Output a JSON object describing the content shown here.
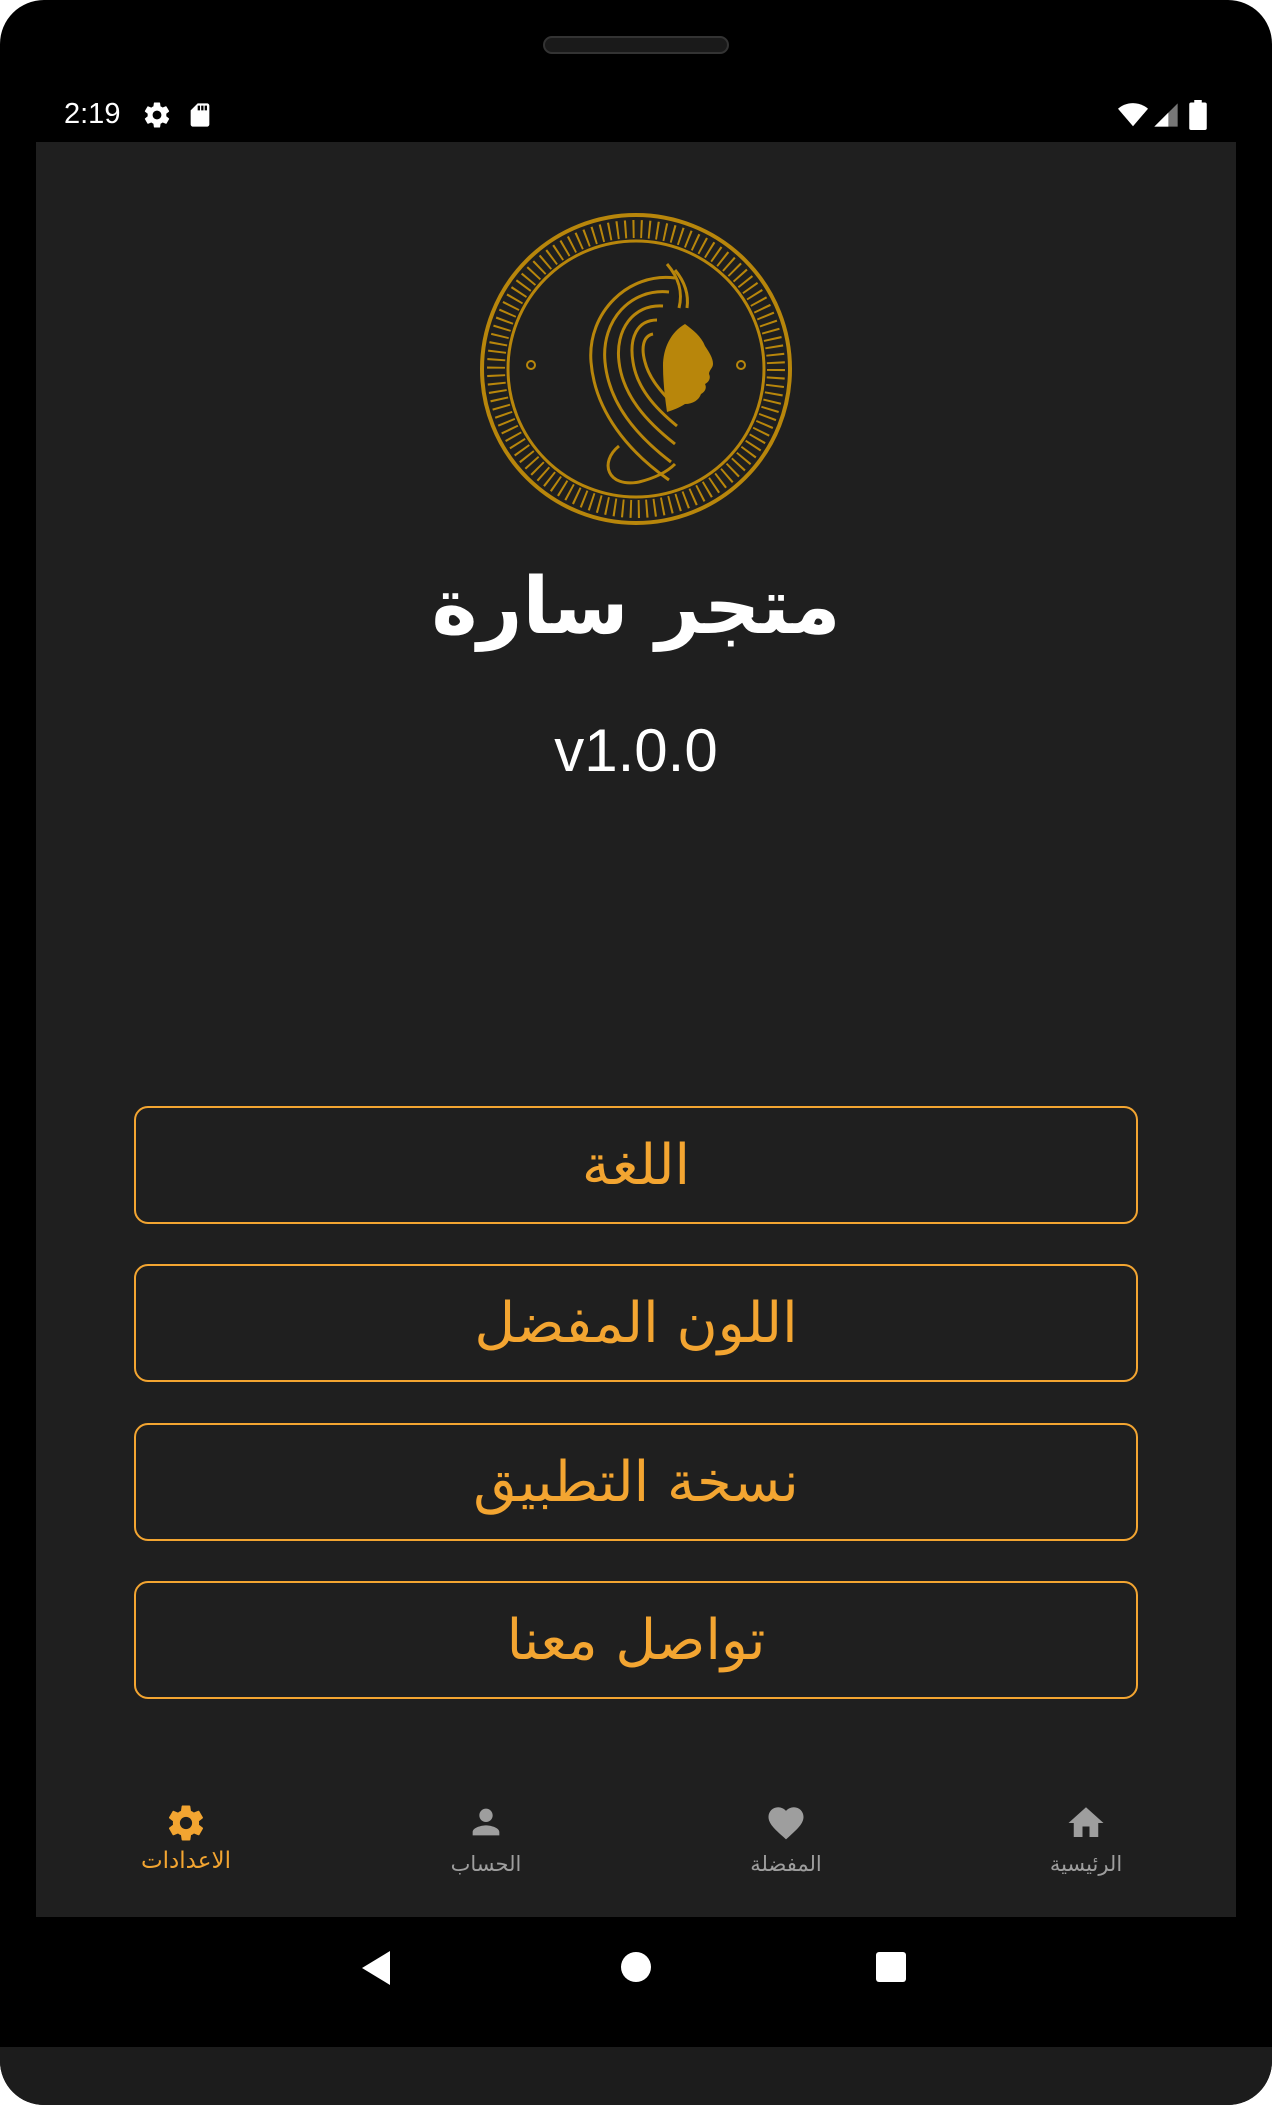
{
  "status_bar": {
    "time": "2:19",
    "left_icons": [
      "gear-icon",
      "sd-card-icon"
    ],
    "right_icons": [
      "wifi-icon",
      "signal-icon",
      "battery-icon"
    ]
  },
  "app": {
    "title": "متجر سارة",
    "version": "v1.0.0",
    "logo": "woman-profile-coin-logo"
  },
  "menu": {
    "language": "اللغة",
    "favorite_color": "اللون المفضل",
    "app_version": "نسخة التطبيق",
    "contact_us": "تواصل معنا"
  },
  "bottom_nav": {
    "settings": "الاعدادات",
    "account": "الحساب",
    "favorites": "المفضلة",
    "home": "الرئيسية"
  },
  "colors": {
    "accent": "#f3a531",
    "logo_gold": "#b8860b",
    "background": "#1f1f1f",
    "inactive_nav": "#9e9e9e"
  }
}
